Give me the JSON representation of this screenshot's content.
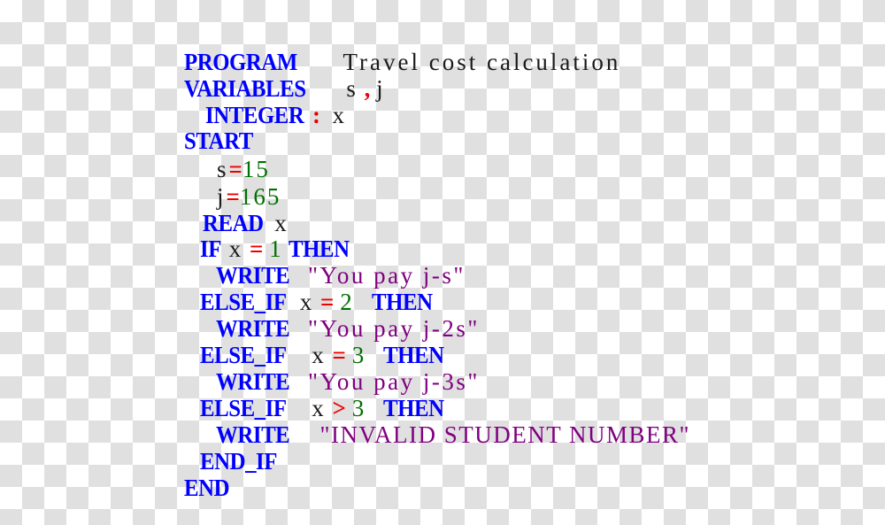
{
  "document": {
    "kind": "pseudocode-listing",
    "title_comment": "Travel cost calculation",
    "colors": {
      "keyword": "#0000ff",
      "operator": "#ee0000",
      "number": "#007000",
      "string": "#800080",
      "identifier": "#1a1a1a",
      "background_light": "#ffffff",
      "background_dark": "#e0e0e0"
    }
  },
  "lines": [
    {
      "n": 1,
      "keyword": "PROGRAM",
      "comment": "Travel cost calculation"
    },
    {
      "n": 2,
      "keyword": "VARIABLES",
      "var_a": "s",
      "comma": ",",
      "var_b": "j"
    },
    {
      "n": 3,
      "keyword": "INTEGER",
      "colon": ":",
      "var": "x"
    },
    {
      "n": 4,
      "keyword": "START"
    },
    {
      "n": 5,
      "var": "s",
      "op": "=",
      "num": "15"
    },
    {
      "n": 6,
      "var": "j",
      "op": "=",
      "num": "165"
    },
    {
      "n": 7,
      "keyword": "READ",
      "var": "x"
    },
    {
      "n": 8,
      "keyword": "IF",
      "var": "x",
      "op": "=",
      "num": "1",
      "keyword2": "THEN"
    },
    {
      "n": 9,
      "keyword": "WRITE",
      "string": "\"You pay j-s\""
    },
    {
      "n": 10,
      "keyword": "ELSE_IF",
      "var": "x",
      "op": "=",
      "num": "2",
      "keyword2": "THEN"
    },
    {
      "n": 11,
      "keyword": "WRITE",
      "string": "\"You pay j-2s\""
    },
    {
      "n": 12,
      "keyword": "ELSE_IF",
      "var": "x",
      "op": "=",
      "num": "3",
      "keyword2": "THEN"
    },
    {
      "n": 13,
      "keyword": "WRITE",
      "string": "\"You pay j-3s\""
    },
    {
      "n": 14,
      "keyword": "ELSE_IF",
      "var": "x",
      "op": ">",
      "num": "3",
      "keyword2": "THEN"
    },
    {
      "n": 15,
      "keyword": "WRITE",
      "string": "\"INVALID STUDENT NUMBER\""
    },
    {
      "n": 16,
      "keyword": "END_IF"
    },
    {
      "n": 17,
      "keyword": "END"
    }
  ]
}
